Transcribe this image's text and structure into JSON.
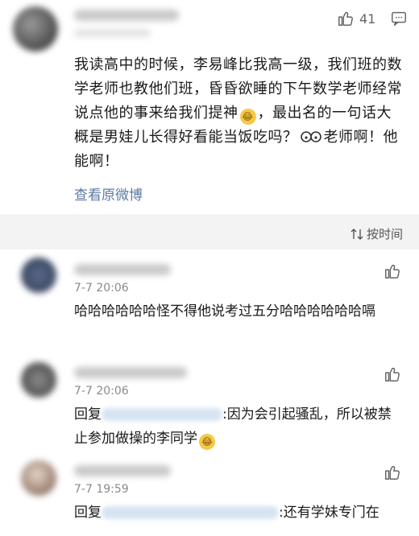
{
  "post": {
    "likes": "41",
    "text_parts": [
      "我读高中的时候，李易峰比我高一级，我们班的数学老师也教他们班，昏昏欲睡的下午数学老师经常说点他的事来给我们提神",
      "，最出名的一句话大概是男娃儿长得好看能当饭吃吗？",
      "老师啊！他能啊！"
    ],
    "view_original": "查看原微博"
  },
  "sort_label": "按时间",
  "comments": [
    {
      "date": "7-7 20:06",
      "text": "哈哈哈哈哈哈怪不得他说考过五分哈哈哈哈哈哈嗝"
    },
    {
      "date": "7-7 20:06",
      "reply_prefix": "回复",
      "text_a": ":因为会引起骚乱，所以被禁止参加做操的李同学"
    },
    {
      "date": "7-7 19:59",
      "reply_prefix": "回复",
      "text_a": ":还有学妹专门在"
    }
  ]
}
